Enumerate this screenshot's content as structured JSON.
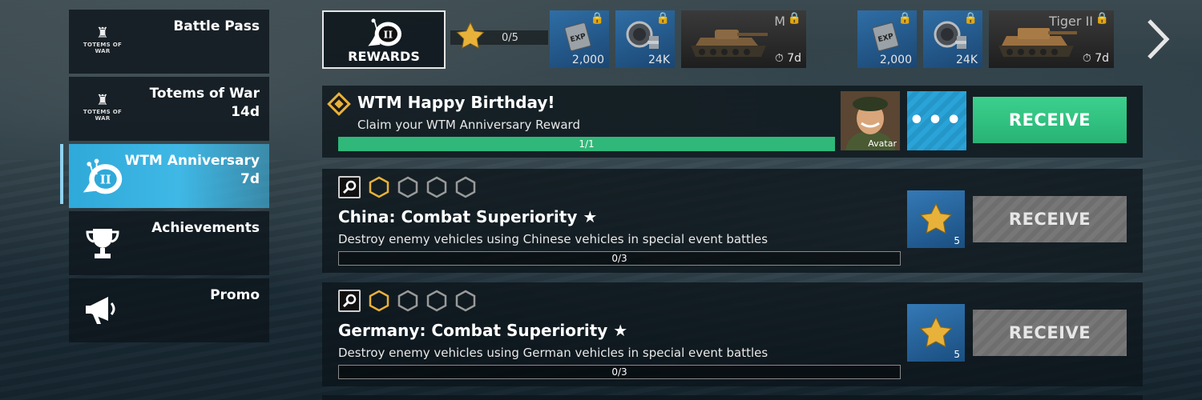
{
  "sidebar": {
    "items": [
      {
        "label": "Battle Pass",
        "sub": "",
        "logo_text": "TOTEMS OF WAR",
        "icon": "totems-of-war-logo"
      },
      {
        "label": "Totems of War",
        "sub": "14d",
        "logo_text": "TOTEMS OF WAR",
        "icon": "totems-of-war-logo"
      },
      {
        "label": "WTM Anniversary",
        "sub": "7d",
        "icon": "snail-ii-icon",
        "active": true
      },
      {
        "label": "Achievements",
        "sub": "",
        "icon": "trophy-icon"
      },
      {
        "label": "Promo",
        "sub": "",
        "icon": "megaphone-icon"
      }
    ]
  },
  "rewards_bar": {
    "rewards_label": "REWARDS",
    "progress": "0/5",
    "items": [
      {
        "type": "exp",
        "value": "2,000"
      },
      {
        "type": "silver",
        "value": "24K"
      },
      {
        "type": "tank",
        "name": "M",
        "timer": "7d"
      },
      {
        "type": "exp",
        "value": "2,000"
      },
      {
        "type": "silver",
        "value": "24K"
      },
      {
        "type": "tank",
        "name": "Tiger II",
        "timer": "7d"
      }
    ]
  },
  "quests": [
    {
      "title": "WTM Happy Birthday!",
      "description": "Claim your WTM Anniversary Reward",
      "progress": "1/1",
      "progress_fraction": 1.0,
      "reward_label": "Avatar",
      "button": "RECEIVE",
      "button_state": "active"
    },
    {
      "title": "China: Combat Superiority ★",
      "description": "Destroy enemy vehicles using Chinese vehicles in special event battles",
      "progress": "0/3",
      "progress_fraction": 0,
      "reward_count": "5",
      "button": "RECEIVE",
      "button_state": "disabled"
    },
    {
      "title": "Germany: Combat Superiority ★",
      "description": "Destroy enemy vehicles using German vehicles in special event battles",
      "progress": "0/3",
      "progress_fraction": 0,
      "reward_count": "5",
      "button": "RECEIVE",
      "button_state": "disabled"
    }
  ],
  "colors": {
    "accent_green": "#2fb879",
    "active_tab": "#3fb8e6",
    "reward_blue": "#2f6ea5",
    "star_gold": "#e8b23a"
  }
}
